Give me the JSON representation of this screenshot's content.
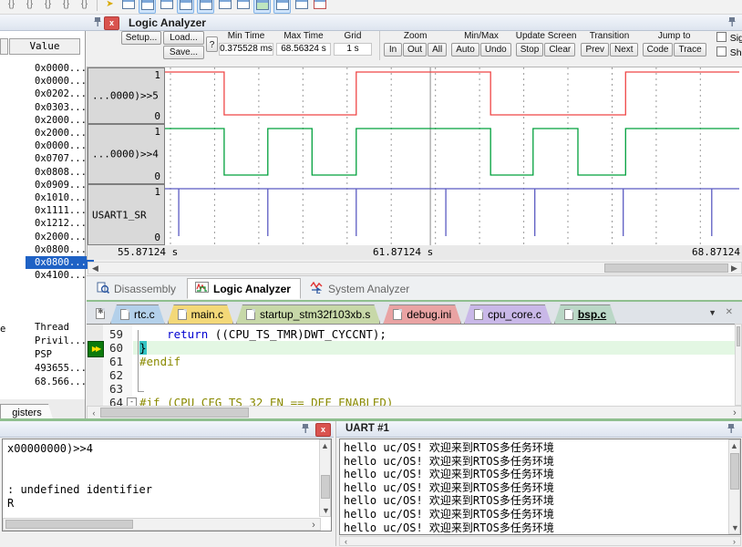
{
  "toolbar": {
    "icons": [
      "step-into-icon",
      "step-over-icon",
      "step-out-icon",
      "run-to-cursor-icon",
      "stop-icon",
      "separator",
      "run-icon",
      "command-window-icon",
      "disassembly-window-icon",
      "symbols-window-icon",
      "registers-window-icon",
      "watch-window-icon",
      "memory-window-icon",
      "serial-window-icon",
      "analysis-window-icon",
      "trace-window-icon",
      "system-viewer-icon",
      "toolbox-icon"
    ]
  },
  "left_panel": {
    "value_header": "Value",
    "values": [
      "0x0000...",
      "0x0000...",
      "0x0202...",
      "0x0303...",
      "0x2000...",
      "0x2000...",
      "0x0000...",
      "0x0707...",
      "0x0808...",
      "0x0909...",
      "0x1010...",
      "0x1111...",
      "0x1212...",
      "0x2000...",
      "0x0800...",
      "0x0800...",
      "0x4100..."
    ],
    "selected_index": 15,
    "register_rows": [
      "Thread",
      "Privil...",
      "PSP",
      "493655...",
      "68.566..."
    ],
    "edge_fragment": "e",
    "tab_label": "gisters"
  },
  "logic_analyzer": {
    "title": "Logic Analyzer",
    "buttons": {
      "setup": "Setup...",
      "load": "Load...",
      "save": "Save...",
      "help": "?"
    },
    "fields": [
      {
        "label": "Min Time",
        "value": "0.375528 ms"
      },
      {
        "label": "Max Time",
        "value": "68.56324 s"
      },
      {
        "label": "Grid",
        "value": "1 s"
      }
    ],
    "groups": [
      {
        "label": "Zoom",
        "buttons": [
          "In",
          "Out",
          "All"
        ]
      },
      {
        "label": "Min/Max",
        "buttons": [
          "Auto",
          "Undo"
        ]
      },
      {
        "label": "Update Screen",
        "buttons": [
          "Stop",
          "Clear"
        ]
      },
      {
        "label": "Transition",
        "buttons": [
          "Prev",
          "Next"
        ]
      },
      {
        "label": "Jump to",
        "buttons": [
          "Code",
          "Trace"
        ]
      }
    ],
    "checkboxes": [
      "Signal Info",
      "Show Cycles"
    ],
    "axis": {
      "left": "55.87124 s",
      "mid": "61.87124 s",
      "right": "68.87124"
    },
    "time_range_s": [
      55.87124,
      68.87124
    ],
    "grid_step_frac": 0.0769,
    "grid_start_frac": 0.0095,
    "cursor_frac": 0.462,
    "channels": [
      {
        "name": "...0000)>>5",
        "color": "#ef4646",
        "type": "square",
        "initial": 1,
        "toggles_frac": [
          0.103,
          0.333,
          0.567,
          0.802
        ]
      },
      {
        "name": "...0000)>>4",
        "color": "#00a03c",
        "type": "square",
        "initial": 1,
        "toggles_frac": [
          0.103,
          0.179,
          0.256,
          0.333,
          0.567,
          0.641,
          0.719,
          0.802
        ]
      },
      {
        "name": "USART1_SR",
        "color": "#5b5bc2",
        "type": "spikes",
        "initial": 1,
        "spikes_frac": [
          0.024,
          0.179,
          0.333,
          0.489,
          0.644,
          0.798,
          0.952
        ]
      }
    ]
  },
  "analyzer_tabs": [
    {
      "label": "Disassembly",
      "active": false
    },
    {
      "label": "Logic Analyzer",
      "active": true
    },
    {
      "label": "System Analyzer",
      "active": false
    }
  ],
  "editor": {
    "tabs": [
      {
        "label": "rtc.c",
        "color": "#b3d0ea",
        "active": false
      },
      {
        "label": "main.c",
        "color": "#f3d878",
        "active": false
      },
      {
        "label": "startup_stm32f103xb.s",
        "color": "#c7d8a8",
        "active": false
      },
      {
        "label": "debug.ini",
        "color": "#e9a3a3",
        "active": false
      },
      {
        "label": "cpu_core.c",
        "color": "#c9b8e8",
        "active": false
      },
      {
        "label": "bsp.c",
        "color": "#bad7c6",
        "active": true
      }
    ],
    "lines": [
      {
        "no": "59",
        "highlight": false,
        "segs": [
          {
            "t": "    "
          },
          {
            "t": "return",
            "c": "kw"
          },
          {
            "t": " ((CPU_TS_TMR)DWT_CYCCNT);"
          }
        ]
      },
      {
        "no": "60",
        "highlight": true,
        "segs": [
          {
            "t": "}",
            "cursor": true
          }
        ]
      },
      {
        "no": "61",
        "highlight": false,
        "segs": [
          {
            "t": "#endif",
            "c": "pp"
          }
        ]
      },
      {
        "no": "62",
        "highlight": false,
        "segs": []
      },
      {
        "no": "63",
        "highlight": false,
        "segs": []
      },
      {
        "no": "64",
        "highlight": false,
        "fold": true,
        "segs": [
          {
            "t": "#if (CPU_CFG_TS_32_EN == DEF_ENABLED)",
            "c": "pp"
          }
        ]
      }
    ]
  },
  "command": {
    "lines": [
      "x00000000)>>4",
      "",
      "",
      ": undefined identifier",
      "R"
    ]
  },
  "uart": {
    "title": "UART #1",
    "lines": [
      "hello uc/OS! 欢迎来到RTOS多任务环境",
      "hello uc/OS! 欢迎来到RTOS多任务环境",
      "hello uc/OS! 欢迎来到RTOS多任务环境",
      "hello uc/OS! 欢迎来到RTOS多任务环境",
      "hello uc/OS! 欢迎来到RTOS多任务环境",
      "hello uc/OS! 欢迎来到RTOS多任务环境",
      "hello uc/OS! 欢迎来到RTOS多任务环境"
    ]
  }
}
